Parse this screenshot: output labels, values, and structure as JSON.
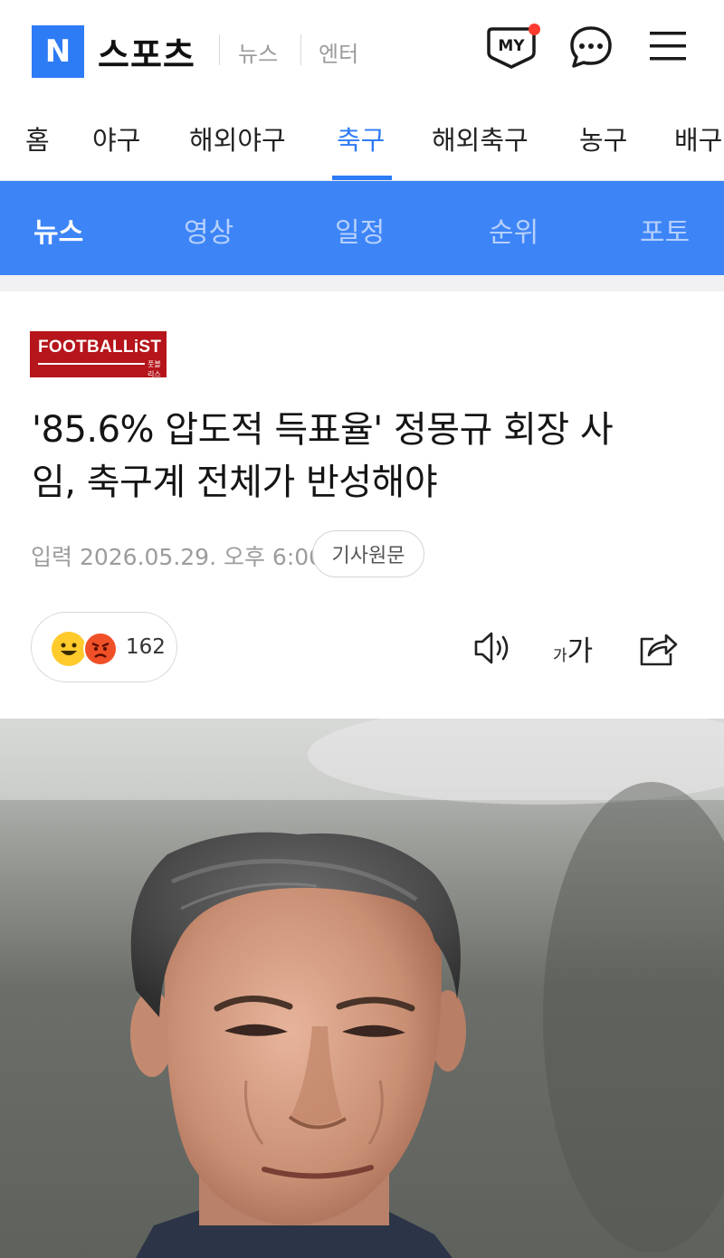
{
  "header": {
    "logo_letter": "N",
    "brand": "스포츠",
    "links": [
      "뉴스",
      "엔터"
    ],
    "my_label": "MY"
  },
  "category_nav": {
    "items": [
      "홈",
      "야구",
      "해외야구",
      "축구",
      "해외축구",
      "농구",
      "배구"
    ],
    "active": "축구"
  },
  "sub_nav": {
    "items": [
      "뉴스",
      "영상",
      "일정",
      "순위",
      "포토"
    ],
    "active": "뉴스"
  },
  "article": {
    "press": {
      "name": "FOOTBALLiST",
      "sub": "풋볼리스트"
    },
    "headline_line1": "'85.6% 압도적 득표율' 정몽규 회장 사",
    "headline_line2": "임, 축구계 전체가 반성해야",
    "date": "입력 2026.05.29. 오후 6:00",
    "original_button": "기사원문",
    "reaction_count": "162",
    "font_size_small": "가",
    "font_size_big": "가"
  },
  "colors": {
    "accent": "#2e7bf6",
    "sub_nav_bg": "#3d84f7",
    "press_red": "#b5151b",
    "notification": "#ff3b30"
  },
  "icons": [
    "my-icon",
    "chat-icon",
    "menu-icon",
    "speaker-icon",
    "font-size-icon",
    "share-icon"
  ]
}
